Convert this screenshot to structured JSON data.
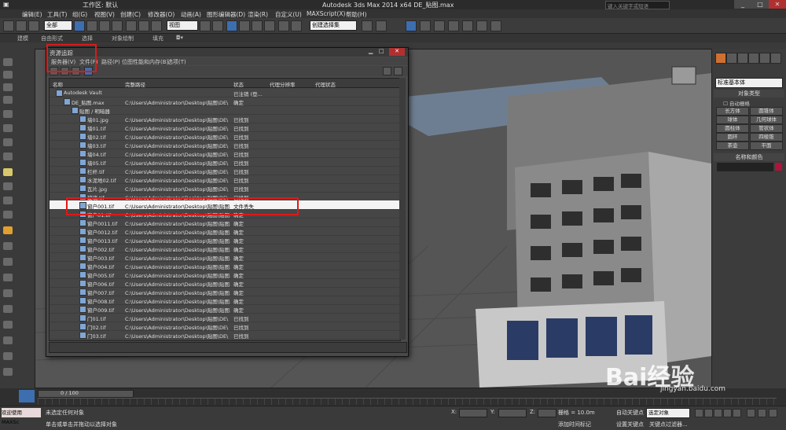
{
  "app": {
    "title": "Autodesk 3ds Max  2014 x64    DE_贴图.max",
    "workspace_label": "工作区: 默认",
    "search_placeholder": "键入关键字或短语"
  },
  "menubar": [
    "编辑(E)",
    "工具(T)",
    "组(G)",
    "视图(V)",
    "创建(C)",
    "修改器(O)",
    "动画(A)",
    "图形编辑器(D)",
    "渲染(R)",
    "自定义(U)",
    "MAXScript(X)",
    "帮助(H)"
  ],
  "toolbar": {
    "filter_value": "全部",
    "view_value": "视图",
    "selection_set_placeholder": "创建选择集"
  },
  "ribbon": [
    "建模",
    "自由形式",
    "选择",
    "对象绘制",
    "填充"
  ],
  "dialog": {
    "title": "资源追踪",
    "menu": [
      "服务器(V)",
      "文件(F)",
      "路径(P)",
      "位图性能和内存(B)",
      "选项(T)"
    ],
    "columns": [
      "名称",
      "完整路径",
      "状态",
      "代理分辨率",
      "代理状态"
    ],
    "rows": [
      {
        "name": "Autodesk Vault",
        "path": "",
        "status": "已注销 (登...",
        "indent": 0
      },
      {
        "name": "DE_贴图.max",
        "path": "C:\\Users\\Administrator\\Desktop\\贴图\\DE\\",
        "status": "确定",
        "indent": 1
      },
      {
        "name": "贴图 / 明暗器",
        "path": "",
        "status": "",
        "indent": 2
      },
      {
        "name": "墙01.jpg",
        "path": "C:\\Users\\Administrator\\Desktop\\贴图\\DE\\",
        "status": "已找到",
        "indent": 3
      },
      {
        "name": "墙01.tif",
        "path": "C:\\Users\\Administrator\\Desktop\\贴图\\DE\\",
        "status": "已找到",
        "indent": 3
      },
      {
        "name": "墙02.tif",
        "path": "C:\\Users\\Administrator\\Desktop\\贴图\\DE\\",
        "status": "已找到",
        "indent": 3
      },
      {
        "name": "墙03.tif",
        "path": "C:\\Users\\Administrator\\Desktop\\贴图\\DE\\",
        "status": "已找到",
        "indent": 3
      },
      {
        "name": "墙04.tif",
        "path": "C:\\Users\\Administrator\\Desktop\\贴图\\DE\\",
        "status": "已找到",
        "indent": 3
      },
      {
        "name": "墙05.tif",
        "path": "C:\\Users\\Administrator\\Desktop\\贴图\\DE\\",
        "status": "已找到",
        "indent": 3
      },
      {
        "name": "栏杆.tif",
        "path": "C:\\Users\\Administrator\\Desktop\\贴图\\DE\\",
        "status": "已找到",
        "indent": 3
      },
      {
        "name": "水泥地02.tif",
        "path": "C:\\Users\\Administrator\\Desktop\\贴图\\DE\\",
        "status": "已找到",
        "indent": 3
      },
      {
        "name": "瓦片.jpg",
        "path": "C:\\Users\\Administrator\\Desktop\\贴图\\DE\\",
        "status": "已找到",
        "indent": 3
      },
      {
        "name": "玻璃.tif",
        "path": "C:\\Users\\Administrator\\Desktop\\贴图\\DE\\",
        "status": "已找到",
        "indent": 3
      },
      {
        "name": "窗户001.tif",
        "path": "C:\\Users\\Administrator\\Desktop\\贴图\\贴图...",
        "status": "文件丢失",
        "indent": 3,
        "highlight": true
      },
      {
        "name": "窗户01.tif",
        "path": "C:\\Users\\Administrator\\Desktop\\贴图\\贴图...",
        "status": "确定",
        "indent": 3
      },
      {
        "name": "窗户0011.tif",
        "path": "C:\\Users\\Administrator\\Desktop\\贴图\\贴图...",
        "status": "确定",
        "indent": 3
      },
      {
        "name": "窗户0012.tif",
        "path": "C:\\Users\\Administrator\\Desktop\\贴图\\贴图...",
        "status": "确定",
        "indent": 3
      },
      {
        "name": "窗户0013.tif",
        "path": "C:\\Users\\Administrator\\Desktop\\贴图\\贴图...",
        "status": "确定",
        "indent": 3
      },
      {
        "name": "窗户002.tif",
        "path": "C:\\Users\\Administrator\\Desktop\\贴图\\贴图...",
        "status": "确定",
        "indent": 3
      },
      {
        "name": "窗户003.tif",
        "path": "C:\\Users\\Administrator\\Desktop\\贴图\\贴图...",
        "status": "确定",
        "indent": 3
      },
      {
        "name": "窗户004.tif",
        "path": "C:\\Users\\Administrator\\Desktop\\贴图\\贴图...",
        "status": "确定",
        "indent": 3
      },
      {
        "name": "窗户005.tif",
        "path": "C:\\Users\\Administrator\\Desktop\\贴图\\贴图...",
        "status": "确定",
        "indent": 3
      },
      {
        "name": "窗户006.tif",
        "path": "C:\\Users\\Administrator\\Desktop\\贴图\\贴图...",
        "status": "确定",
        "indent": 3
      },
      {
        "name": "窗户007.tif",
        "path": "C:\\Users\\Administrator\\Desktop\\贴图\\贴图...",
        "status": "确定",
        "indent": 3
      },
      {
        "name": "窗户008.tif",
        "path": "C:\\Users\\Administrator\\Desktop\\贴图\\贴图...",
        "status": "确定",
        "indent": 3
      },
      {
        "name": "窗户009.tif",
        "path": "C:\\Users\\Administrator\\Desktop\\贴图\\贴图...",
        "status": "确定",
        "indent": 3
      },
      {
        "name": "门01.tif",
        "path": "C:\\Users\\Administrator\\Desktop\\贴图\\DE\\",
        "status": "已找到",
        "indent": 3
      },
      {
        "name": "门02.tif",
        "path": "C:\\Users\\Administrator\\Desktop\\贴图\\DE\\",
        "status": "已找到",
        "indent": 3
      },
      {
        "name": "门03.tif",
        "path": "C:\\Users\\Administrator\\Desktop\\贴图\\DE\\",
        "status": "已找到",
        "indent": 3
      }
    ]
  },
  "command_panel": {
    "dropdown": "标准基本体",
    "section_object_type": "对象类型",
    "autogrid": "自动栅格",
    "buttons": [
      "长方体",
      "圆锥体",
      "球体",
      "几何球体",
      "圆柱体",
      "管状体",
      "圆环",
      "四棱锥",
      "茶壶",
      "平面"
    ],
    "section_name_color": "名称和颜色",
    "name_color_swatch": "#b0143a"
  },
  "timeline": {
    "frame": "0 / 100"
  },
  "status": {
    "welcome": "欢迎使用 MAXSc",
    "line1": "未选定任何对象",
    "line2": "单击或单击并拖动以选择对象",
    "x_label": "X:",
    "y_label": "Y:",
    "z_label": "Z:",
    "grid": "栅格 = 10.0m",
    "add_time_tag": "添加时间标记",
    "auto_key": "自动关键点",
    "selected_label": "选定对象",
    "set_key": "设置关键点",
    "key_filters": "关键点过滤器..."
  },
  "watermark": {
    "brand": "Bai经验",
    "url": "jingyan.baidu.com"
  }
}
